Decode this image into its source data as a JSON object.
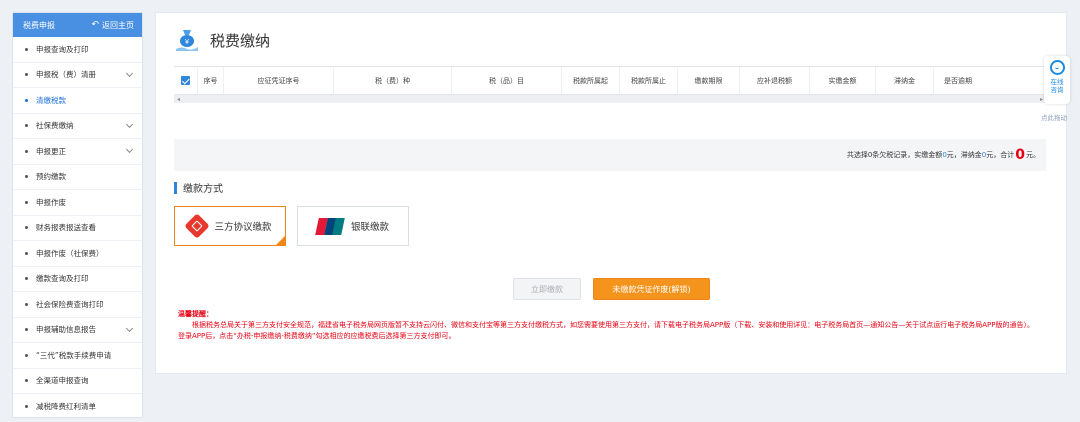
{
  "sidebar": {
    "header_title": "税费申报",
    "back_label": "返回主页",
    "items": [
      {
        "label": "申报查询及打印",
        "expandable": false,
        "active": false
      },
      {
        "label": "申报税（费）清册",
        "expandable": true,
        "active": false
      },
      {
        "label": "清缴税款",
        "expandable": false,
        "active": true
      },
      {
        "label": "社保费缴纳",
        "expandable": true,
        "active": false
      },
      {
        "label": "申报更正",
        "expandable": true,
        "active": false
      },
      {
        "label": "预约缴款",
        "expandable": false,
        "active": false
      },
      {
        "label": "申报作废",
        "expandable": false,
        "active": false
      },
      {
        "label": "财务报表报送查看",
        "expandable": false,
        "active": false
      },
      {
        "label": "申报作废（社保费）",
        "expandable": false,
        "active": false
      },
      {
        "label": "缴款查询及打印",
        "expandable": false,
        "active": false
      },
      {
        "label": "社会保险费查询打印",
        "expandable": false,
        "active": false
      },
      {
        "label": "申报辅助信息报告",
        "expandable": true,
        "active": false
      },
      {
        "label": "“三代”税款手续费申请",
        "expandable": false,
        "active": false
      },
      {
        "label": "全渠道申报查询",
        "expandable": false,
        "active": false
      },
      {
        "label": "减税降费红利清单",
        "expandable": false,
        "active": false
      }
    ]
  },
  "page": {
    "title": "税费缴纳"
  },
  "table": {
    "columns": [
      "序号",
      "应征凭证序号",
      "税（费）种",
      "税（品）目",
      "税款所属起",
      "税款所属止",
      "缴款期限",
      "应补退税额",
      "实缴金额",
      "滞纳金",
      "是否逾期"
    ]
  },
  "summary": {
    "prefix": "共选择0条欠税记录，实缴金额",
    "amount1": "0",
    "mid1": "元，滞纳金",
    "amount2": "0",
    "mid2": "元，",
    "total_label": "合计",
    "total": "0",
    "suffix": "元。"
  },
  "payment": {
    "section_title": "缴款方式",
    "options": [
      {
        "label": "三方协议缴款",
        "selected": true
      },
      {
        "label": "银联缴款",
        "selected": false
      }
    ],
    "unionpay_logo_text": "UnionPay 银联"
  },
  "actions": {
    "pay_now": "立即缴款",
    "void_voucher": "未缴款凭证作废(解锁)"
  },
  "tips": {
    "title": "温馨提醒：",
    "body": "根据税务总局关于第三方支付安全规范，福建省电子税务局网页版暂不支持云闪付、微信和支付宝等第三方支付缴税方式，如您需要使用第三方支付，请下载电子税务局APP版（下载、安装和使用详见：电子税务局首页—通知公告—关于试点运行电子税务局APP版的通告）。登录APP后，点击“办税-申报缴纳-税费缴纳”勾选相应的应缴税费后选择第三方支付即可。"
  },
  "float": {
    "consult_line1": "在线",
    "consult_line2": "咨询",
    "drag_hint": "点此拖动"
  },
  "colors": {
    "primary": "#4a90e2",
    "accent_orange": "#f5941d",
    "warning_red": "#e60012"
  }
}
